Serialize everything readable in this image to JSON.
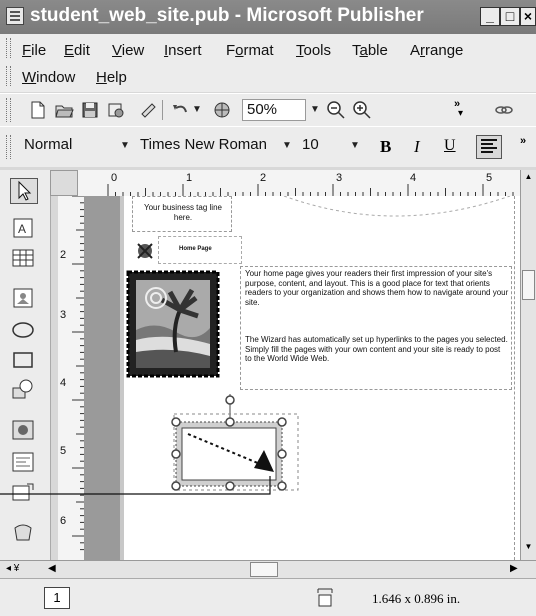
{
  "window": {
    "title": "student_web_site.pub - Microsoft Publisher",
    "controls": {
      "minimize": "_",
      "maximize": "□",
      "close": "×"
    }
  },
  "menubar": {
    "items": [
      {
        "label": "File",
        "accel": "F",
        "rest": "ile"
      },
      {
        "label": "Edit",
        "accel": "E",
        "rest": "dit"
      },
      {
        "label": "View",
        "accel": "V",
        "rest": "iew"
      },
      {
        "label": "Insert",
        "accel": "I",
        "rest": "nsert"
      },
      {
        "label": "Format",
        "pre": "F",
        "accel": "o",
        "rest": "rmat"
      },
      {
        "label": "Tools",
        "accel": "T",
        "rest": "ools"
      },
      {
        "label": "Table",
        "pre": "T",
        "accel": "a",
        "rest": "ble"
      },
      {
        "label": "Arrange",
        "pre": "A",
        "accel": "r",
        "rest": "range"
      },
      {
        "label": "Window",
        "accel": "W",
        "rest": "indow"
      },
      {
        "label": "Help",
        "accel": "H",
        "rest": "elp"
      }
    ]
  },
  "standard_toolbar": {
    "zoom": "50%"
  },
  "formatting_toolbar": {
    "style": "Normal",
    "font": "Times New Roman",
    "size": "10",
    "bold": "B",
    "italic": "I",
    "underline": "U"
  },
  "rulers": {
    "top_numbers": [
      "0",
      "1",
      "2",
      "3",
      "4",
      "5"
    ],
    "left_numbers": [
      "2",
      "3",
      "4",
      "5",
      "6"
    ]
  },
  "page": {
    "tagline_text": "Your business tag line here.",
    "nav_label": "Home Page",
    "paragraph1": "Your home page gives your readers their first impression of your site's purpose, content, and layout. This is a good place for text that orients readers to your organization and shows them how to navigate around your site.",
    "paragraph2": "The Wizard has automatically set up hyperlinks to the pages you selected. Simply fill the pages with your own content and your site is ready to post to the World Wide Web."
  },
  "status": {
    "page_number": "1",
    "size_readout": "1.646 x 0.896 in."
  }
}
